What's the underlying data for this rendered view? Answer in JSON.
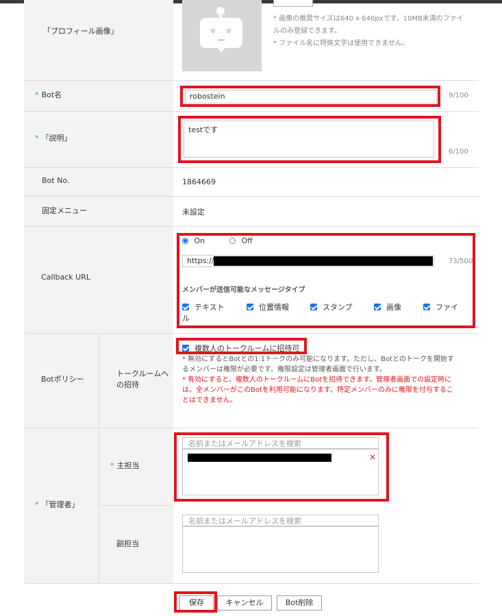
{
  "profile": {
    "label": "「プロフィール画像」",
    "notes": [
      "* 画像の推奨サイズは640 x 640pxです。10MB未満のファイ",
      "ルのみ登録できます。",
      "* ファイル名に特殊文字は使用できません。"
    ]
  },
  "bot_name": {
    "required_mark": "*",
    "label": "Bot名",
    "value": "robostein",
    "count": "9/100"
  },
  "description": {
    "required_mark": "*",
    "label": "「説明」",
    "value": "testです",
    "count": "6/100"
  },
  "bot_no": {
    "label": "Bot No.",
    "value": "1864669"
  },
  "fixed_menu": {
    "label": "固定メニュー",
    "value": "未設定"
  },
  "callback": {
    "label": "Callback URL",
    "on_label": "On",
    "off_label": "Off",
    "url_value": "https://",
    "count": "73/500",
    "message_types_title": "メンバーが送信可能なメッセージタイプ",
    "types": [
      "テキスト",
      "位置情報",
      "スタンプ",
      "画像",
      "ファイ"
    ],
    "types_wrap": "ル"
  },
  "policy": {
    "label": "Botポリシー",
    "sub_label_1": "トークルームへ",
    "sub_label_2": "の招待",
    "checkbox_label": "複数人のトークルームに招待可",
    "note_gray": [
      "* 無効にするとBotとの1:1トークのみ可能になります。ただし、Botとのトークを開始す",
      "るメンバーは権限が必要です。権限設定は管理者画面で行います。"
    ],
    "note_red": [
      "* 有効にすると、複数人のトークルームにBotを招待できます。管理者画面での設定時に",
      "は、全メンバーがこのBotを利用可能になります。特定メンバーのみに権限を付与するこ",
      "とはできません。"
    ]
  },
  "admin": {
    "required_mark": "*",
    "label": "「管理者」",
    "main_label": "主担当",
    "sub_label": "副担当",
    "search_placeholder": "名前またはメールアドレスを検索",
    "remove_symbol": "×"
  },
  "buttons": {
    "save": "保存",
    "cancel": "キャンセル",
    "delete": "Bot削除"
  },
  "colors": {
    "highlight": "#e0141e",
    "required": "#19a974",
    "accent": "#1a73e8",
    "note_red": "#e0141e"
  }
}
